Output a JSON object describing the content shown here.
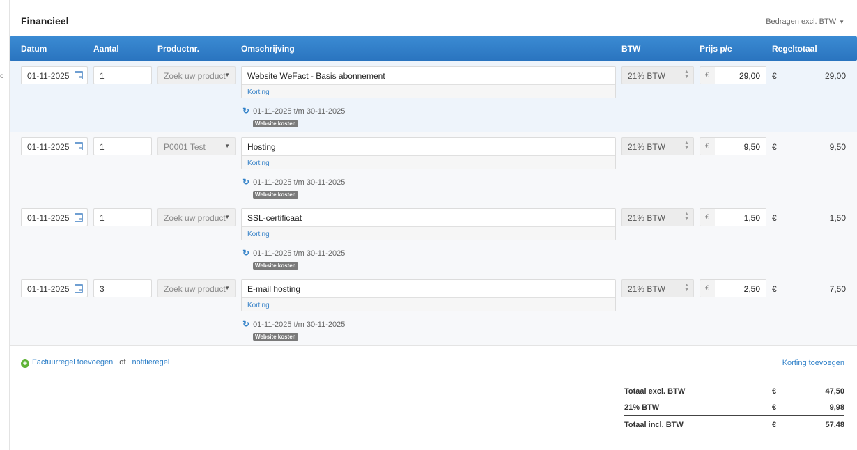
{
  "left_marker": "c",
  "section": {
    "title": "Financieel",
    "amount_mode": "Bedragen excl. BTW"
  },
  "columns": {
    "datum": "Datum",
    "aantal": "Aantal",
    "productnr": "Productnr.",
    "omschrijving": "Omschrijving",
    "btw": "BTW",
    "prijs": "Prijs p/e",
    "regeltotaal": "Regeltotaal"
  },
  "rows": [
    {
      "date": "01-11-2025",
      "qty": "1",
      "product": "Zoek uw product",
      "description": "Website WeFact - Basis abonnement",
      "korting": "Korting",
      "period": "01-11-2025 t/m 30-11-2025",
      "tag": "Website kosten",
      "btw": "21% BTW",
      "currency": "€",
      "price": "29,00",
      "total": "29,00"
    },
    {
      "date": "01-11-2025",
      "qty": "1",
      "product": "P0001 Test",
      "description": "Hosting",
      "korting": "Korting",
      "period": "01-11-2025 t/m 30-11-2025",
      "tag": "Website kosten",
      "btw": "21% BTW",
      "currency": "€",
      "price": "9,50",
      "total": "9,50"
    },
    {
      "date": "01-11-2025",
      "qty": "1",
      "product": "Zoek uw product",
      "description": "SSL-certificaat",
      "korting": "Korting",
      "period": "01-11-2025 t/m 30-11-2025",
      "tag": "Website kosten",
      "btw": "21% BTW",
      "currency": "€",
      "price": "1,50",
      "total": "1,50"
    },
    {
      "date": "01-11-2025",
      "qty": "3",
      "product": "Zoek uw product",
      "description": "E-mail hosting",
      "korting": "Korting",
      "period": "01-11-2025 t/m 30-11-2025",
      "tag": "Website kosten",
      "btw": "21% BTW",
      "currency": "€",
      "price": "2,50",
      "total": "7,50"
    }
  ],
  "footer": {
    "add_line": "Factuurregel toevoegen",
    "of": "of",
    "add_note": "notitieregel",
    "add_discount": "Korting toevoegen"
  },
  "totals": [
    {
      "label": "Totaal excl. BTW",
      "currency": "€",
      "amount": "47,50"
    },
    {
      "label": "21% BTW",
      "currency": "€",
      "amount": "9,98"
    },
    {
      "label": "Totaal incl. BTW",
      "currency": "€",
      "amount": "57,48"
    }
  ]
}
